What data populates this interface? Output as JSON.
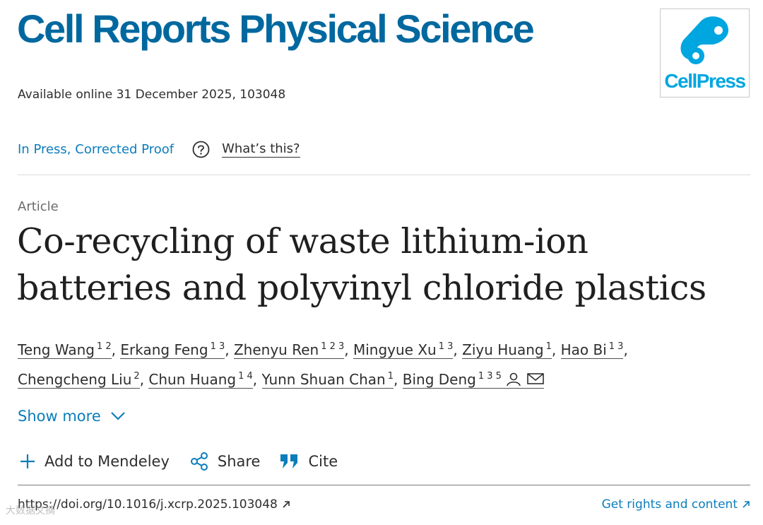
{
  "journal": {
    "title": "Cell Reports Physical Science"
  },
  "logo": {
    "brand": "CellPress",
    "accent": "#00a6e0"
  },
  "availability": "Available online 31 December 2025, 103048",
  "status": {
    "label": "In Press, Corrected Proof",
    "help_icon": "question-circle-icon",
    "whats_this": "What’s this?"
  },
  "article": {
    "type": "Article",
    "title": "Co-recycling of waste lithium-ion batteries and polyvinyl chloride plastics"
  },
  "authors": [
    {
      "name": "Teng Wang",
      "aff": "1 2"
    },
    {
      "name": "Erkang Feng",
      "aff": "1 3"
    },
    {
      "name": "Zhenyu Ren",
      "aff": "1 2 3"
    },
    {
      "name": "Mingyue Xu",
      "aff": "1 3"
    },
    {
      "name": "Ziyu Huang",
      "aff": "1"
    },
    {
      "name": "Hao Bi",
      "aff": "1 3"
    },
    {
      "name": "Chengcheng Liu",
      "aff": "2"
    },
    {
      "name": "Chun Huang",
      "aff": "1 4"
    },
    {
      "name": "Yunn Shuan Chan",
      "aff": "1"
    },
    {
      "name": "Bing Deng",
      "aff": "1 3 5"
    }
  ],
  "show_more": "Show more",
  "actions": {
    "mendeley": "Add to Mendeley",
    "share": "Share",
    "cite": "Cite"
  },
  "doi": "https://doi.org/10.1016/j.xcrp.2025.103048",
  "rights": "Get rights and content",
  "watermark": "大数据文摘",
  "colors": {
    "brand_blue": "#00689f",
    "link_blue": "#0c7dbb",
    "text": "#2e2e2e"
  }
}
